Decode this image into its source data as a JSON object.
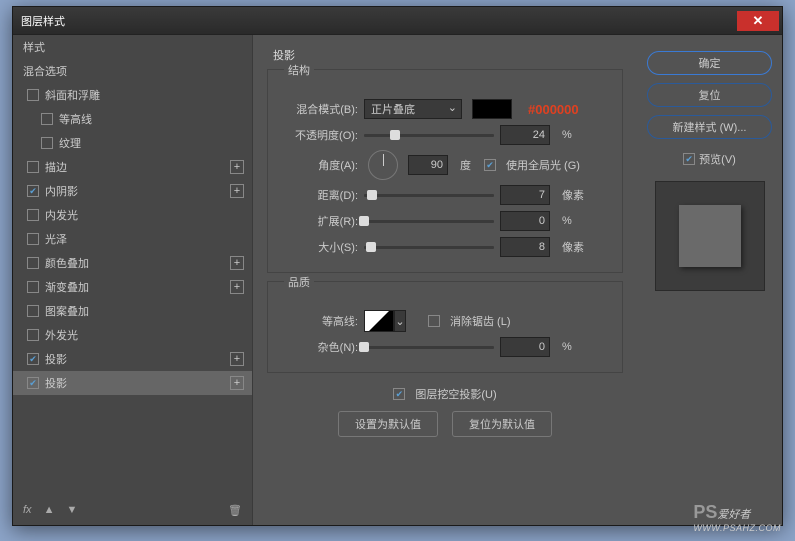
{
  "window": {
    "title": "图层样式"
  },
  "sidebar": {
    "styles_header": "样式",
    "blend_header": "混合选项",
    "items": [
      {
        "label": "斜面和浮雕",
        "checked": false,
        "plus": false,
        "sub": false
      },
      {
        "label": "等高线",
        "checked": false,
        "plus": false,
        "sub": true
      },
      {
        "label": "纹理",
        "checked": false,
        "plus": false,
        "sub": true
      },
      {
        "label": "描边",
        "checked": false,
        "plus": true,
        "sub": false
      },
      {
        "label": "内阴影",
        "checked": true,
        "plus": true,
        "sub": false
      },
      {
        "label": "内发光",
        "checked": false,
        "plus": false,
        "sub": false
      },
      {
        "label": "光泽",
        "checked": false,
        "plus": false,
        "sub": false
      },
      {
        "label": "颜色叠加",
        "checked": false,
        "plus": true,
        "sub": false
      },
      {
        "label": "渐变叠加",
        "checked": false,
        "plus": true,
        "sub": false
      },
      {
        "label": "图案叠加",
        "checked": false,
        "plus": false,
        "sub": false
      },
      {
        "label": "外发光",
        "checked": false,
        "plus": false,
        "sub": false
      },
      {
        "label": "投影",
        "checked": true,
        "plus": true,
        "sub": false
      },
      {
        "label": "投影",
        "checked": true,
        "plus": true,
        "sub": false,
        "selected": true
      }
    ],
    "fx": "fx",
    "up": "▲",
    "down": "▼",
    "trash": "🗑"
  },
  "main": {
    "title": "投影",
    "structure": {
      "legend": "结构",
      "blend_label": "混合模式(B):",
      "blend_value": "正片叠底",
      "hex": "#000000",
      "opacity_label": "不透明度(O):",
      "opacity": "24",
      "opacity_unit": "%",
      "angle_label": "角度(A):",
      "angle": "90",
      "angle_unit": "度",
      "global_label": "使用全局光 (G)",
      "global_checked": true,
      "distance_label": "距离(D):",
      "distance": "7",
      "distance_unit": "像素",
      "spread_label": "扩展(R):",
      "spread": "0",
      "spread_unit": "%",
      "size_label": "大小(S):",
      "size": "8",
      "size_unit": "像素"
    },
    "quality": {
      "legend": "品质",
      "contour_label": "等高线:",
      "aa_label": "消除锯齿 (L)",
      "aa_checked": false,
      "noise_label": "杂色(N):",
      "noise": "0",
      "noise_unit": "%"
    },
    "knockout_label": "图层挖空投影(U)",
    "knockout_checked": true,
    "default_set": "设置为默认值",
    "default_reset": "复位为默认值"
  },
  "right": {
    "ok": "确定",
    "cancel": "复位",
    "newstyle": "新建样式 (W)...",
    "preview": "预览(V)",
    "preview_checked": true
  },
  "watermark": {
    "ps": "PS",
    "text": "爱好者",
    "url": "WWW.PSAHZ.COM"
  }
}
